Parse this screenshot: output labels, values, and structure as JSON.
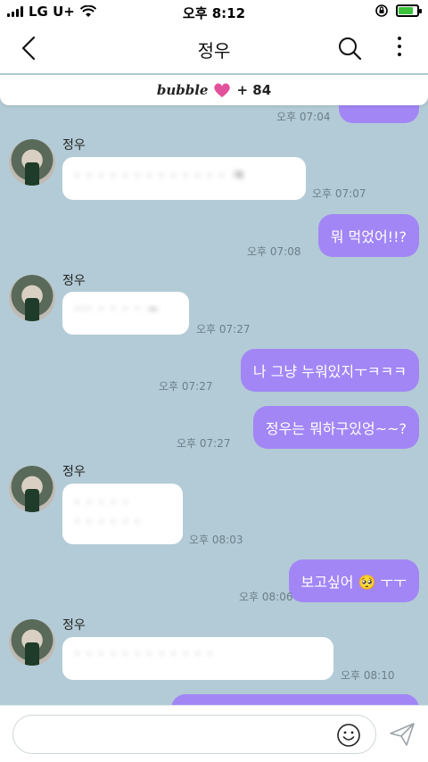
{
  "status": {
    "carrier": "LG U+",
    "time": "오후 8:12",
    "battery_level": 0.8
  },
  "header": {
    "title": "정우"
  },
  "bubble": {
    "brand": "bubble",
    "count": "+ 84"
  },
  "messages": [
    {
      "time": "오후 07:04"
    },
    {
      "sender": "정우",
      "text": "·  ·  ·   ·  ·  ·  ·  ·  ·  ·  ·  ·  ·  ㅋ",
      "time": "오후 07:07"
    },
    {
      "text": "뭐 먹었어!!?",
      "time": "오후 07:08"
    },
    {
      "sender": "정우",
      "text": "···  ·  · · ·  ~",
      "time": "오후 07:27"
    },
    {
      "text": "나 그냥 누워있지ㅜㅋㅋㅋ",
      "time": "오후 07:27"
    },
    {
      "text": "정우는 뭐하구있엉~~?",
      "time": "오후 07:27"
    },
    {
      "sender": "정우",
      "text1": "· ·  ·  ·  ·",
      "text2": "·  ·  ·  ·  ·  ·",
      "time": "오후 08:03"
    },
    {
      "text": "보고싶어",
      "emoji": "🥺",
      "suffix": "ㅜㅜ",
      "time": "오후 08:06"
    },
    {
      "sender": "정우",
      "text": "·    ·  ·  ·  ·  ·  ·  ·  ·  ·  ·  ·",
      "time": "오후 08:10"
    }
  ]
}
